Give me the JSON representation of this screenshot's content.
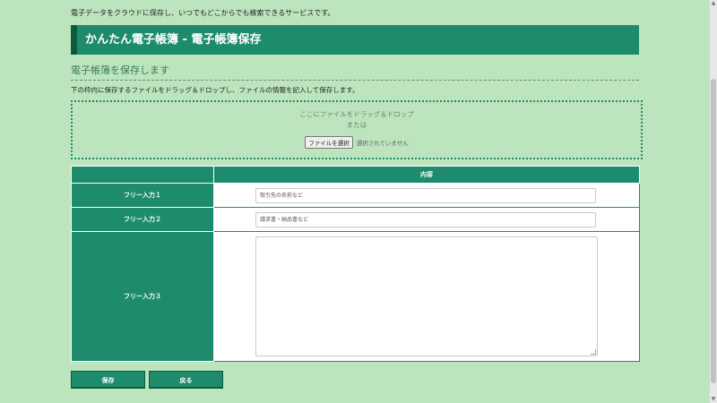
{
  "header": {
    "tagline": "電子データをクラウドに保存し、いつでもどこからでも検索できるサービスです。",
    "title": "かんたん電子帳簿 - 電子帳簿保存"
  },
  "section": {
    "title": "電子帳簿を保存します",
    "instruction": "下の枠内に保存するファイルをドラッグ＆ドロップし、ファイルの情報を記入して保存します。"
  },
  "dropzone": {
    "line1": "ここにファイルをドラッグ＆ドロップ",
    "line2": "または",
    "file_button": "ファイルを選択",
    "file_status": "選択されていません"
  },
  "table": {
    "header_label": "",
    "header_content": "内容",
    "rows": [
      {
        "label": "フリー入力１",
        "placeholder": "取引先の名前など"
      },
      {
        "label": "フリー入力２",
        "placeholder": "請求書・納品書など"
      },
      {
        "label": "フリー入力３",
        "placeholder": ""
      }
    ]
  },
  "actions": {
    "save": "保存",
    "back": "戻る"
  },
  "colors": {
    "background": "#bde5bd",
    "accent": "#1e8c6c",
    "accent_dark": "#0d5a3f"
  }
}
